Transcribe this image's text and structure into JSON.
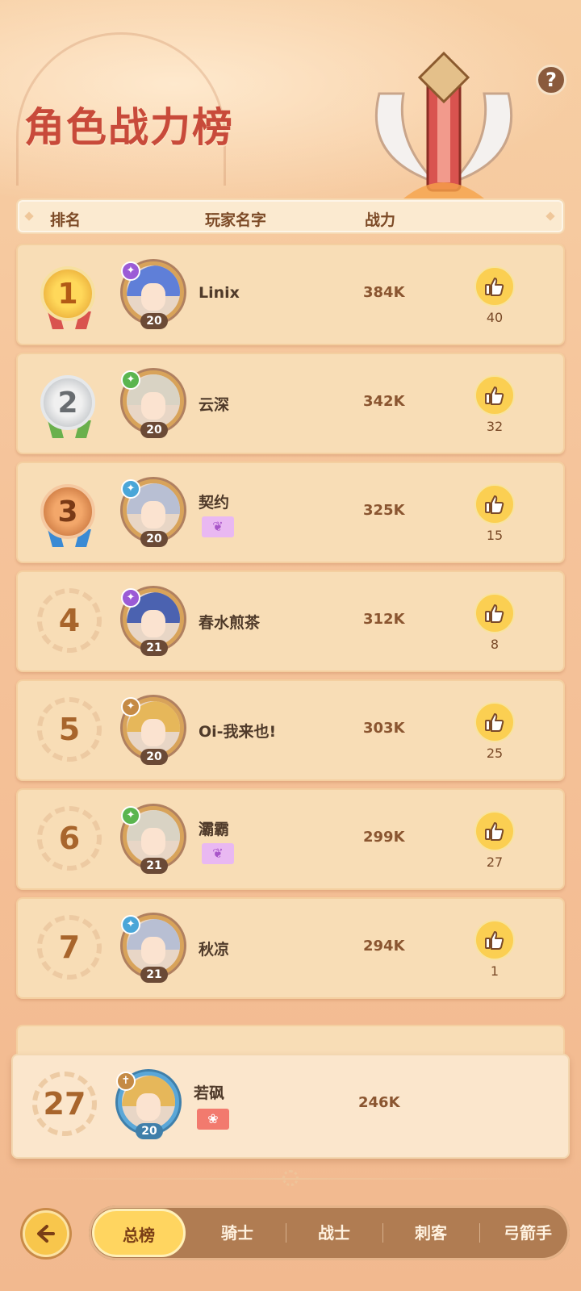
{
  "title": "角色战力榜",
  "help_label": "?",
  "columns": {
    "rank": "排名",
    "player": "玩家名字",
    "power": "战力"
  },
  "rows": [
    {
      "rank": "1",
      "rank_style": "gold",
      "name": "Linix",
      "level": "20",
      "power": "384K",
      "likes": "40",
      "class_color": "#9b5bd6",
      "hair_color": "#5f7fd8",
      "badge": ""
    },
    {
      "rank": "2",
      "rank_style": "silver",
      "name": "云深",
      "level": "20",
      "power": "342K",
      "likes": "32",
      "class_color": "#5ab54f",
      "hair_color": "#d9d3c4",
      "badge": ""
    },
    {
      "rank": "3",
      "rank_style": "bronze",
      "name": "契约",
      "level": "20",
      "power": "325K",
      "likes": "15",
      "class_color": "#4aa6d8",
      "hair_color": "#b8bfd3",
      "badge": "wings"
    },
    {
      "rank": "4",
      "rank_style": "plain",
      "name": "春水煎茶",
      "level": "21",
      "power": "312K",
      "likes": "8",
      "class_color": "#9b5bd6",
      "hair_color": "#4b62b0",
      "badge": ""
    },
    {
      "rank": "5",
      "rank_style": "plain",
      "name": "Oi-我来也!",
      "level": "20",
      "power": "303K",
      "likes": "25",
      "class_color": "#c58a44",
      "hair_color": "#e6b75a",
      "badge": ""
    },
    {
      "rank": "6",
      "rank_style": "plain",
      "name": "灞霸",
      "level": "21",
      "power": "299K",
      "likes": "27",
      "class_color": "#5ab54f",
      "hair_color": "#d9d3c4",
      "badge": "wings"
    },
    {
      "rank": "7",
      "rank_style": "plain",
      "name": "秋凉",
      "level": "21",
      "power": "294K",
      "likes": "1",
      "class_color": "#4aa6d8",
      "hair_color": "#b8bfd3",
      "badge": ""
    }
  ],
  "self": {
    "rank": "27",
    "name": "若砜",
    "level": "20",
    "power": "246K",
    "class_color": "#c58a44",
    "hair_color": "#e6b75a",
    "badge": "bear"
  },
  "tabs": [
    {
      "label": "总榜",
      "active": true
    },
    {
      "label": "骑士",
      "active": false
    },
    {
      "label": "战士",
      "active": false
    },
    {
      "label": "刺客",
      "active": false
    },
    {
      "label": "弓箭手",
      "active": false
    }
  ]
}
